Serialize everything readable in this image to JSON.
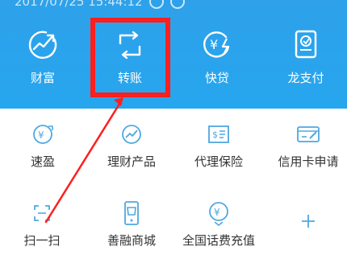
{
  "status_bar": {
    "time_text": "2017/07/25 15:44:12"
  },
  "top_menu": [
    {
      "label": "财富",
      "icon": "growth-chart-icon"
    },
    {
      "label": "转账",
      "icon": "transfer-icon"
    },
    {
      "label": "快贷",
      "icon": "quick-loan-icon"
    },
    {
      "label": "龙支付",
      "icon": "dragon-pay-icon"
    }
  ],
  "services_row1": [
    {
      "label": "速盈",
      "icon": "yuan-swap-icon"
    },
    {
      "label": "理财产品",
      "icon": "wealth-chart-icon"
    },
    {
      "label": "代理保险",
      "icon": "insurance-card-icon"
    },
    {
      "label": "信用卡申请",
      "icon": "credit-card-edit-icon"
    }
  ],
  "services_row2": [
    {
      "label": "扫一扫",
      "icon": "scan-icon"
    },
    {
      "label": "善融商城",
      "icon": "mall-phone-icon"
    },
    {
      "label": "全国话费充值",
      "icon": "phone-recharge-icon"
    },
    {
      "label": "",
      "icon": "plus-icon"
    }
  ],
  "colors": {
    "brand_blue": "#26a6ee",
    "highlight_red": "#ff1f1f",
    "icon_blue": "#4fa8e0",
    "text_dark": "#333333"
  }
}
